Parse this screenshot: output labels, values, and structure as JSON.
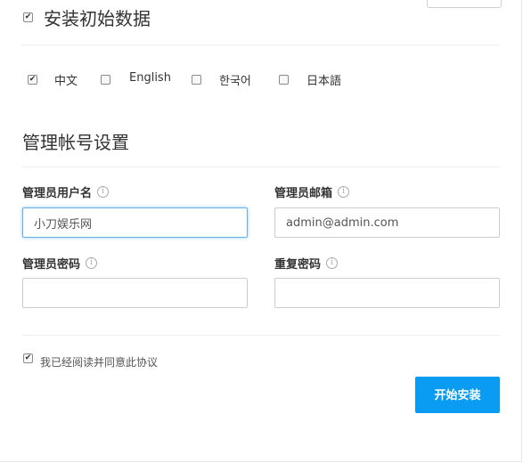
{
  "install": {
    "checkbox_checked": true,
    "title": "安装初始数据",
    "languages": [
      {
        "label": "中文",
        "checked": true
      },
      {
        "label": "English",
        "checked": false
      },
      {
        "label": "한국어",
        "checked": false
      },
      {
        "label": "日本語",
        "checked": false
      }
    ]
  },
  "admin": {
    "section_title": "管理帐号设置",
    "username": {
      "label": "管理员用户名",
      "value": "小刀娱乐网",
      "info_icon": "info-icon"
    },
    "email": {
      "label": "管理员邮箱",
      "value": "admin@admin.com",
      "info_icon": "info-icon"
    },
    "password": {
      "label": "管理员密码",
      "value": "",
      "info_icon": "info-icon"
    },
    "repeat_password": {
      "label": "重复密码",
      "value": "",
      "info_icon": "info-icon"
    }
  },
  "agreement": {
    "label": "我已经阅读并同意此协议",
    "checked": true
  },
  "start_button": {
    "label": "开始安装"
  },
  "colors": {
    "accent": "#0a9cf2",
    "focus_border": "#66afe9"
  }
}
